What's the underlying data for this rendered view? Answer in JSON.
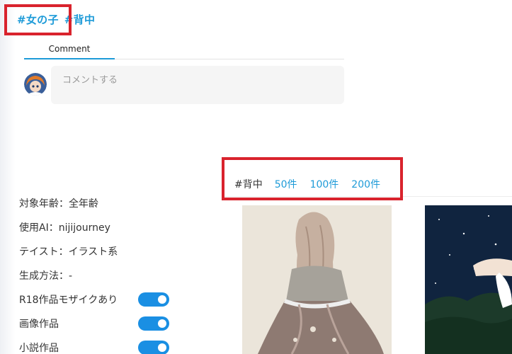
{
  "tags": [
    {
      "label": "#女の子"
    },
    {
      "label": "#背中"
    }
  ],
  "comment_section": {
    "tab_label": "Comment",
    "input_placeholder": "コメントする"
  },
  "filter": {
    "tag_label": "#背中",
    "options": [
      "50件",
      "100件",
      "200件"
    ]
  },
  "attributes": [
    {
      "label": "対象年齢：全年齢"
    },
    {
      "label": "使用AI：nijijourney"
    },
    {
      "label": "テイスト：イラスト系"
    },
    {
      "label": "生成方法：-"
    }
  ],
  "toggles": [
    {
      "label": "R18作品モザイクあり",
      "on": true
    },
    {
      "label": "画像作品",
      "on": true
    },
    {
      "label": "小説作品",
      "on": true
    }
  ],
  "colors": {
    "accent": "#1e9bd8",
    "toggle_on": "#1a8fe3",
    "highlight": "#d9232d"
  }
}
